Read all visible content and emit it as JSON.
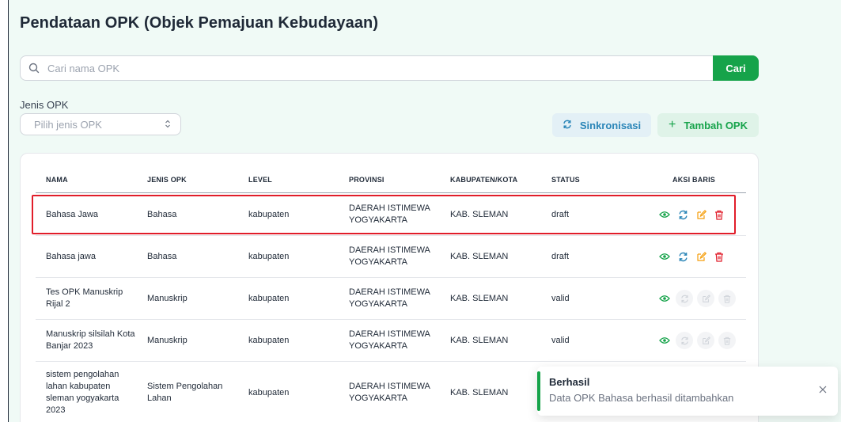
{
  "page": {
    "title": "Pendataan OPK (Objek Pemajuan Kebudayaan)"
  },
  "search": {
    "placeholder": "Cari nama OPK",
    "button_label": "Cari"
  },
  "filter": {
    "label": "Jenis OPK",
    "placeholder": "Pilih jenis OPK"
  },
  "toolbar": {
    "sync_label": "Sinkronisasi",
    "add_label": "Tambah OPK",
    "add_plus": "+"
  },
  "table": {
    "columns": [
      "NAMA",
      "JENIS OPK",
      "LEVEL",
      "PROVINSI",
      "KABUPATEN/KOTA",
      "STATUS",
      "AKSI BARIS"
    ],
    "rows": [
      {
        "nama": "Bahasa Jawa",
        "jenis": "Bahasa",
        "level": "kabupaten",
        "provinsi": "DAERAH ISTIMEWA YOGYAKARTA",
        "kabupaten": "KAB. SLEMAN",
        "status": "draft"
      },
      {
        "nama": "Bahasa jawa",
        "jenis": "Bahasa",
        "level": "kabupaten",
        "provinsi": "DAERAH ISTIMEWA YOGYAKARTA",
        "kabupaten": "KAB. SLEMAN",
        "status": "draft"
      },
      {
        "nama": "Tes OPK Manuskrip Rijal 2",
        "jenis": "Manuskrip",
        "level": "kabupaten",
        "provinsi": "DAERAH ISTIMEWA YOGYAKARTA",
        "kabupaten": "KAB. SLEMAN",
        "status": "valid"
      },
      {
        "nama": "Manuskrip silsilah Kota Banjar 2023",
        "jenis": "Manuskrip",
        "level": "kabupaten",
        "provinsi": "DAERAH ISTIMEWA YOGYAKARTA",
        "kabupaten": "KAB. SLEMAN",
        "status": "valid"
      },
      {
        "nama": "sistem pengolahan lahan kabupaten sleman yogyakarta 2023",
        "jenis": "Sistem Pengolahan Lahan",
        "level": "kabupaten",
        "provinsi": "DAERAH ISTIMEWA YOGYAKARTA",
        "kabupaten": "KAB. SLEMAN",
        "status": ""
      }
    ]
  },
  "toast": {
    "title": "Berhasil",
    "message": "Data OPK Bahasa berhasil ditambahkan"
  },
  "colors": {
    "accent": "#16a34a",
    "sync": "#2b86b8",
    "edit": "#f59e0b",
    "delete": "#e11d2a",
    "highlight": "#e11d2a"
  }
}
